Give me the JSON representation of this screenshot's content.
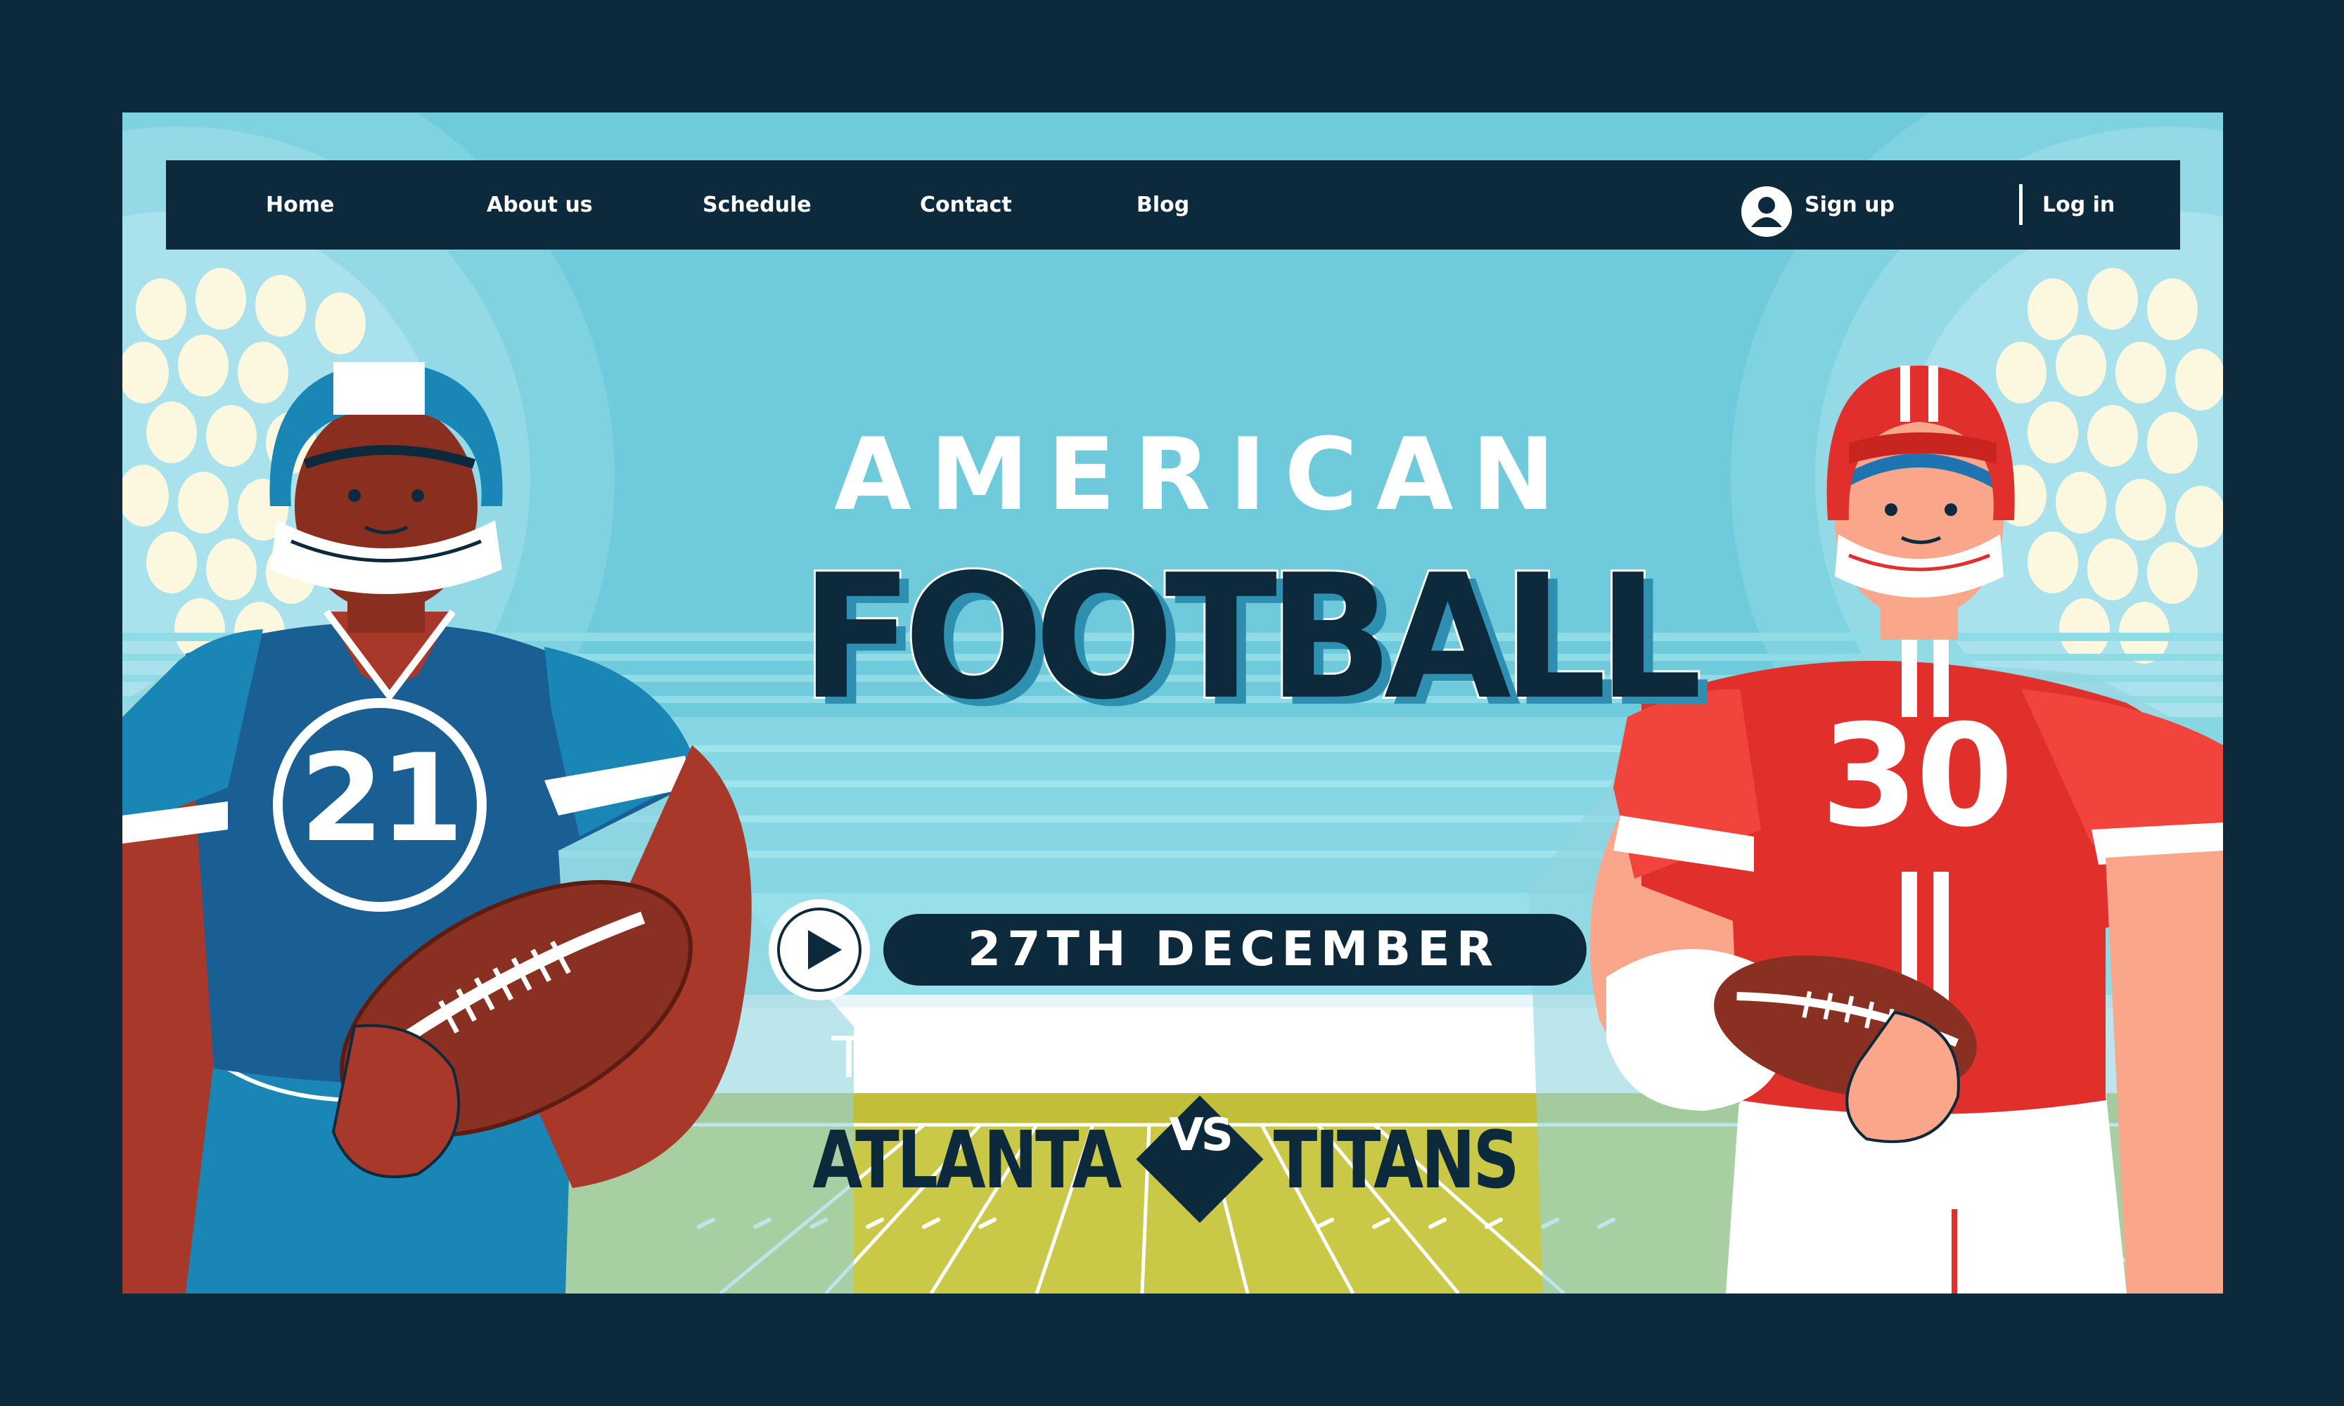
{
  "nav": {
    "links": [
      "Home",
      "About us",
      "Schedule",
      "Contact",
      "Blog"
    ],
    "sign_up": "Sign up",
    "log_in": "Log in"
  },
  "hero": {
    "title_line1": "AMERICAN",
    "title_line2": "FOOTBALL",
    "date": "27TH DECEMBER",
    "team_label": "TEAM",
    "team1": "ATLANTA",
    "vs": "VS",
    "team2": "TITANS"
  },
  "players": {
    "left_number": "21",
    "right_number": "30"
  },
  "colors": {
    "navy": "#0d2a3d",
    "sky": "#6fcbdb",
    "blue_team": "#1a5f94",
    "red_team": "#e1302b",
    "field": "#c1bf3a"
  },
  "icons": [
    "user-icon",
    "play-icon"
  ]
}
